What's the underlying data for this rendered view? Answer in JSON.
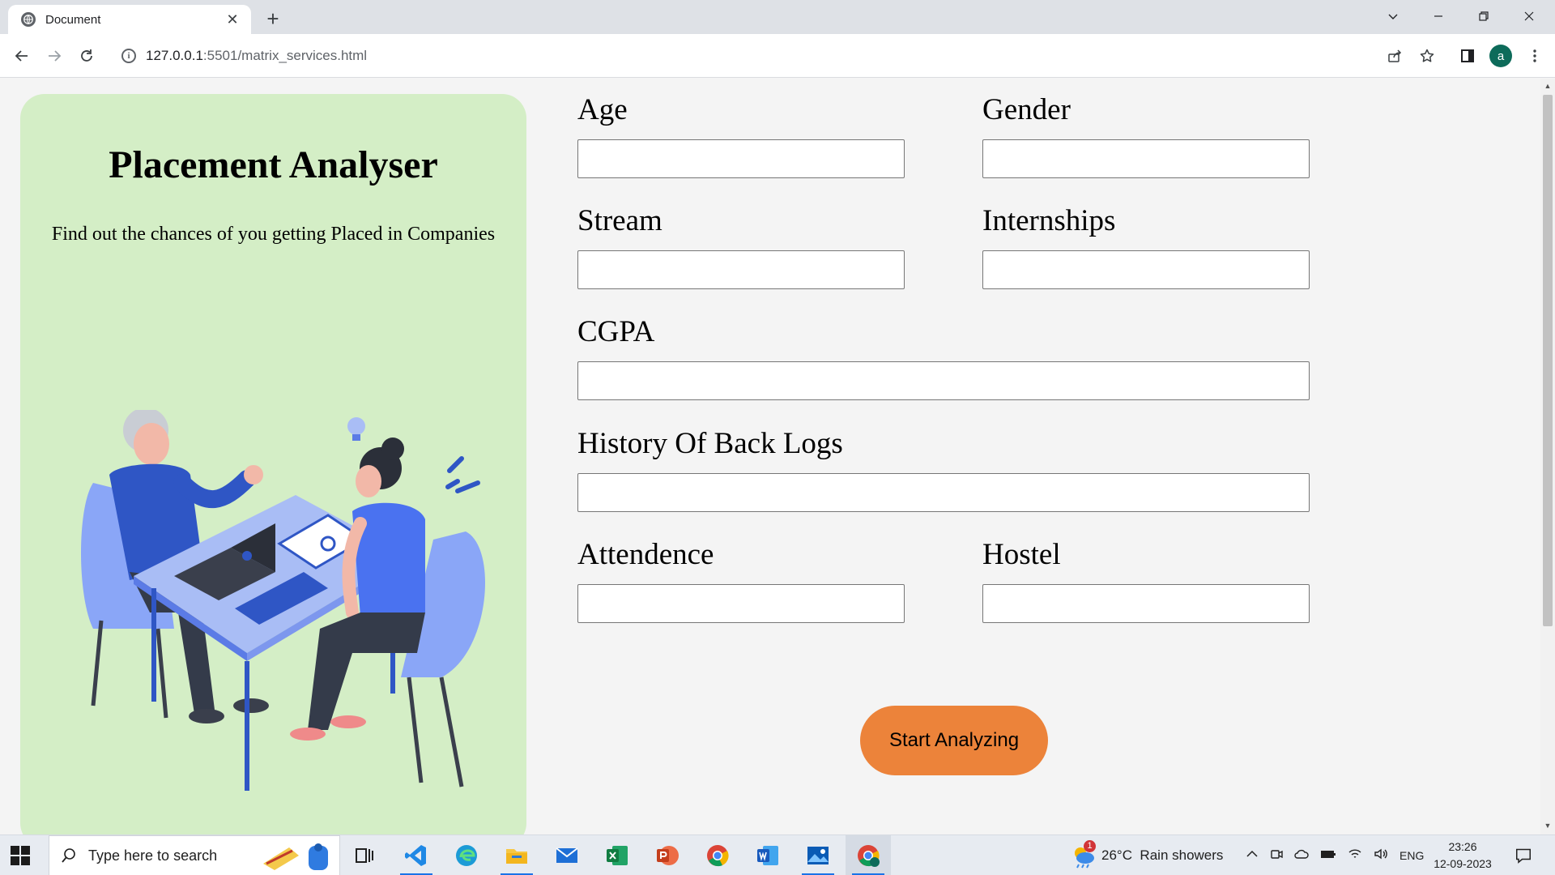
{
  "browser": {
    "tab_title": "Document",
    "url_host": "127.0.0.1",
    "url_path": ":5501/matrix_services.html",
    "avatar_letter": "a"
  },
  "page": {
    "title": "Placement Analyser",
    "subtitle": "Find out the chances of you getting Placed in Companies",
    "fields": {
      "age": "Age",
      "gender": "Gender",
      "stream": "Stream",
      "internships": "Internships",
      "cgpa": "CGPA",
      "backlogs": "History Of Back Logs",
      "attendence": "Attendence",
      "hostel": "Hostel"
    },
    "submit_label": "Start Analyzing",
    "accent_color": "#ec833a",
    "panel_color": "#d4eec6"
  },
  "taskbar": {
    "search_placeholder": "Type here to search",
    "weather": "26°C  Rain showers",
    "weather_badge": "1",
    "language": "ENG",
    "time": "23:26",
    "date": "12-09-2023",
    "apps": [
      "task-view",
      "vscode",
      "edge",
      "file-explorer",
      "mail",
      "excel",
      "powerpoint",
      "chrome",
      "word",
      "photos",
      "chrome-profile"
    ]
  }
}
